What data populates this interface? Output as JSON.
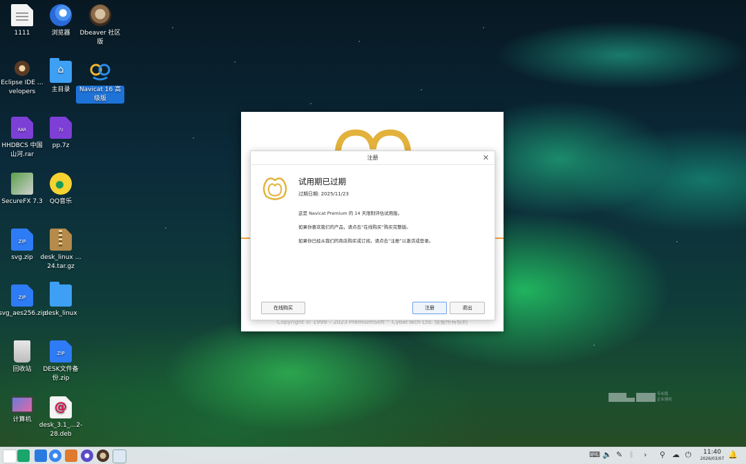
{
  "desktop": {
    "icons": [
      {
        "label": "1111"
      },
      {
        "label": "浏览器"
      },
      {
        "label": "Dbeaver 社区版"
      },
      {
        "label": "Eclipse IDE …velopers"
      },
      {
        "label": "主目录"
      },
      {
        "label": "Navicat 16 高级版"
      },
      {
        "label": "HHDBCS 中国山河.rar",
        "badge": "RAR"
      },
      {
        "label": "pp.7z",
        "badge": "7z"
      },
      {
        "label": "SecureFX 7.3"
      },
      {
        "label": "QQ音乐"
      },
      {
        "label": "svg.zip",
        "badge": "ZIP"
      },
      {
        "label": "desk_linux …24.tar.gz"
      },
      {
        "label": "svg_aes256.zip",
        "badge": "ZIP"
      },
      {
        "label": "desk_linux"
      },
      {
        "label": "回收站"
      },
      {
        "label": "DESK文件备份.zip",
        "badge": "ZIP"
      },
      {
        "label": "计算机"
      },
      {
        "label": "desk_3.1_…2-28.deb"
      }
    ]
  },
  "background_window": {
    "copyright": "Copyright © 1999 – 2023 PremiumSoft™ CyberTech Ltd. 保留所有权利"
  },
  "dialog": {
    "title": "注册",
    "close": "✕",
    "heading": "试用期已过期",
    "expiry": "过期日期: 2025/11/23",
    "line1": "这是 Navicat Premium 的 14 天限制评估试用版。",
    "line2": "如果你喜欢我们的产品，请点击“在线购买”购买完整版。",
    "line3": "如果你已经从我们的商店购买或订阅，请点击“注册”以激活或登录。",
    "buy_button": "在线购买",
    "register_button": "注册",
    "exit_button": "退出",
    "accent_color": "#e3b23c"
  },
  "watermark": {
    "line1": "专业版",
    "line2": "企业授权"
  },
  "taskbar": {
    "time": "11:40",
    "date": "2026/03/07"
  }
}
